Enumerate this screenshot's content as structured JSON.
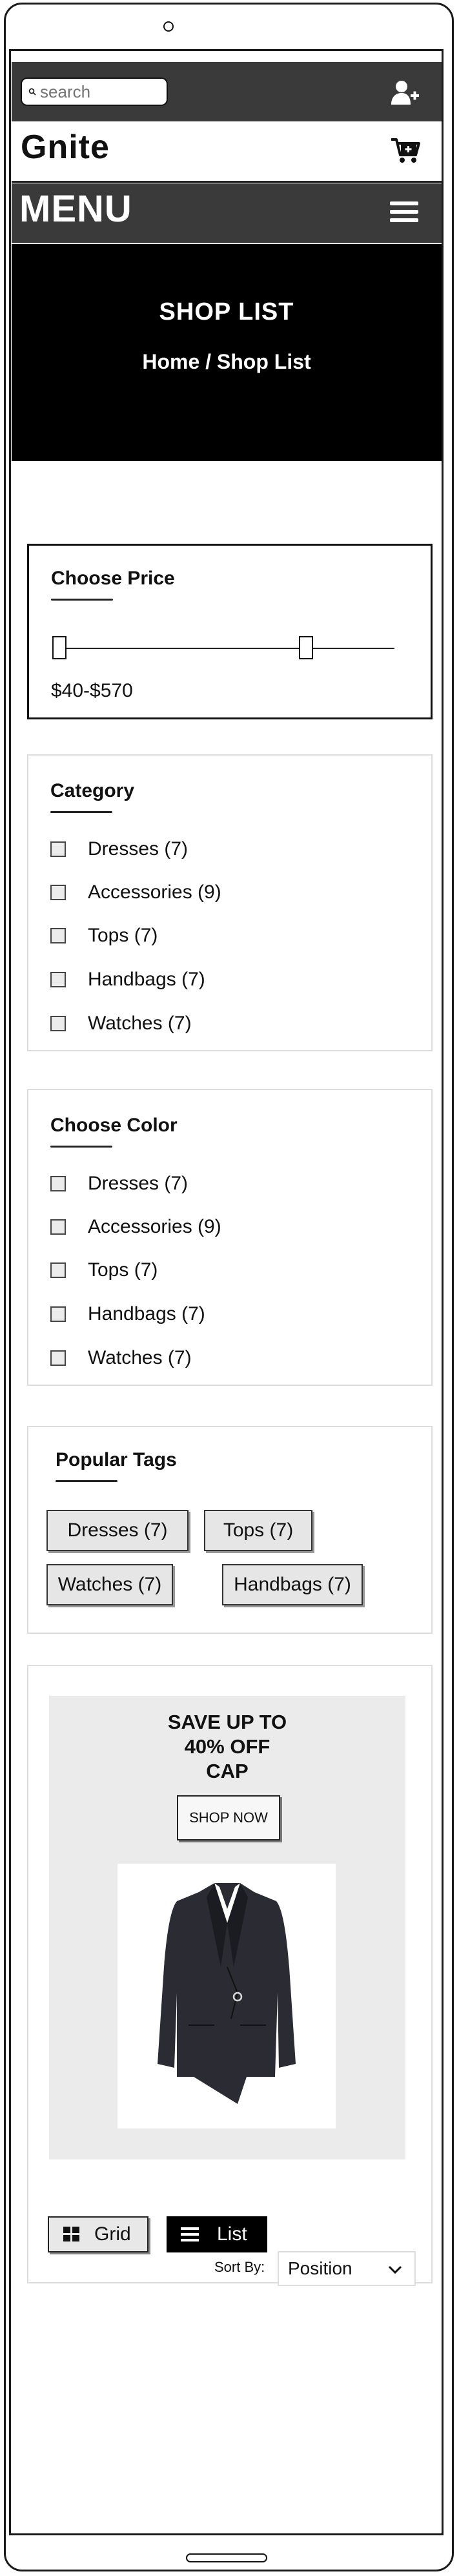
{
  "header": {
    "search_placeholder": "search",
    "brand": "Gnite",
    "menu_label": "MENU"
  },
  "hero": {
    "title": "SHOP LIST",
    "breadcrumb": "Home / Shop List"
  },
  "price_filter": {
    "title": "Choose Price",
    "range_text": "$40-$570",
    "min_value": 40,
    "max_value": 570
  },
  "category": {
    "title": "Category",
    "items": [
      {
        "label": "Dresses (7)"
      },
      {
        "label": "Accessories (9)"
      },
      {
        "label": "Tops (7)"
      },
      {
        "label": "Handbags (7)"
      },
      {
        "label": "Watches (7)"
      }
    ]
  },
  "color": {
    "title": "Choose Color",
    "items": [
      {
        "label": "Dresses (7)"
      },
      {
        "label": "Accessories (9)"
      },
      {
        "label": "Tops (7)"
      },
      {
        "label": "Handbags (7)"
      },
      {
        "label": "Watches (7)"
      }
    ]
  },
  "tags": {
    "title": "Popular Tags",
    "items": [
      {
        "label": "Dresses (7)"
      },
      {
        "label": "Tops (7)"
      },
      {
        "label": "Watches (7)"
      },
      {
        "label": "Handbags (7)"
      }
    ]
  },
  "promo": {
    "line1": "SAVE UP TO",
    "line2": "40% OFF",
    "line3": "CAP",
    "button": "SHOP NOW"
  },
  "view": {
    "grid_label": "Grid",
    "list_label": "List",
    "sort_label": "Sort By:",
    "sort_value": "Position"
  },
  "icons": {
    "user": "add-user-icon",
    "cart": "cart-icon",
    "menu": "hamburger-icon",
    "search": "search-icon",
    "grid": "grid-icon",
    "list": "list-icon",
    "chevron": "chevron-down-icon"
  }
}
